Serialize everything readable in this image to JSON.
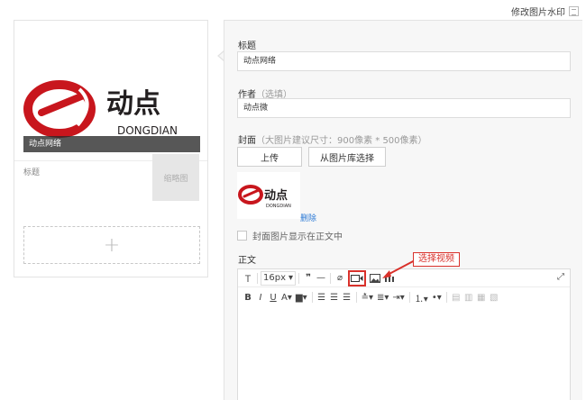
{
  "watermark": {
    "label": "修改图片水印"
  },
  "preview": {
    "cover_caption": "动点网络",
    "item_title": "标题",
    "thumb_label": "缩略图",
    "add_symbol": "+"
  },
  "form": {
    "title_label": "标题",
    "title_value": "动点网络",
    "author_label": "作者",
    "author_hint": "（选填）",
    "author_value": "动点微",
    "cover_label": "封面",
    "cover_hint": "（大图片建议尺寸：900像素 * 500像素）",
    "upload_button": "上传",
    "library_button": "从图片库选择",
    "delete_link": "删除",
    "show_cover_label": "封面图片显示在正文中",
    "body_label": "正文"
  },
  "editor": {
    "font_size": "16px",
    "callout_text": "选择视频"
  },
  "logo": {
    "brand_cn": "动点",
    "brand_en": "DONGDIAN",
    "colors": {
      "red": "#c8161d",
      "dark": "#231f20"
    }
  }
}
